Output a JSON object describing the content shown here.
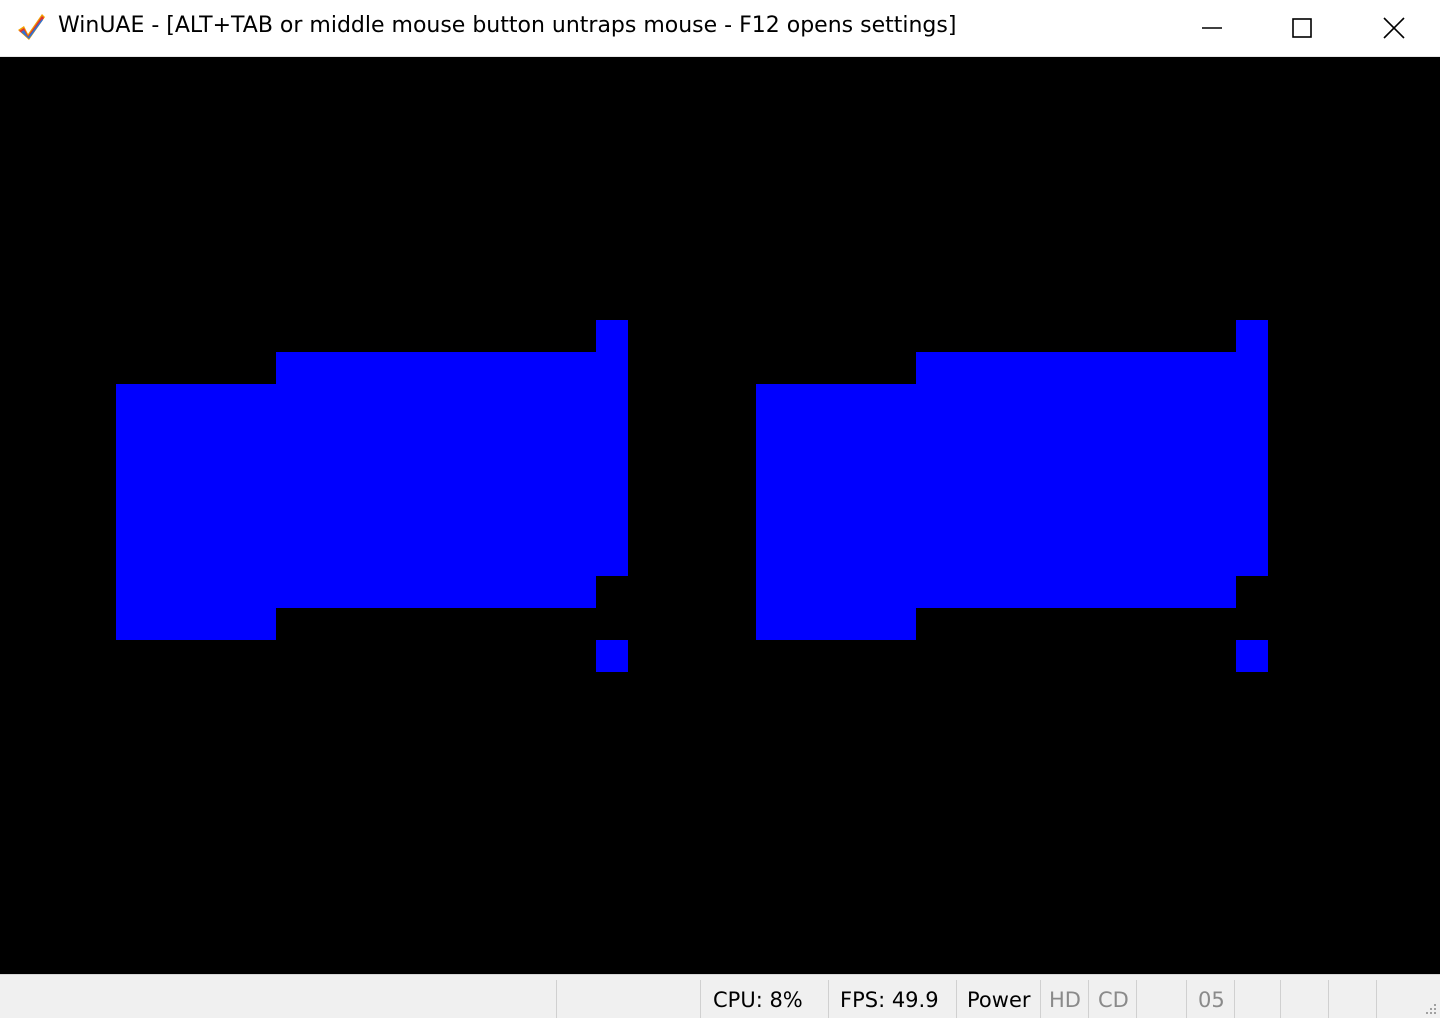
{
  "window": {
    "title": "WinUAE - [ALT+TAB or middle mouse button untraps mouse - F12 opens settings]",
    "app_icon": "winuae-checkmark-icon",
    "controls": {
      "minimize_icon": "minimize-icon",
      "maximize_icon": "maximize-icon",
      "close_icon": "close-icon"
    }
  },
  "display": {
    "background_color": "#000000",
    "graphic_color": "#0000ff",
    "graphic": "two blue pixel shapes on black emulator screen"
  },
  "statusbar": {
    "cells": [
      {
        "id": "blank-1",
        "label": ""
      },
      {
        "id": "blank-2",
        "label": ""
      },
      {
        "id": "cpu",
        "label": "CPU: 8%"
      },
      {
        "id": "fps",
        "label": "FPS: 49.9"
      },
      {
        "id": "power",
        "label": "Power"
      },
      {
        "id": "hd",
        "label": "HD"
      },
      {
        "id": "cd",
        "label": "CD"
      },
      {
        "id": "blank-3",
        "label": ""
      },
      {
        "id": "drive-df0",
        "label": "05"
      },
      {
        "id": "drive-df1",
        "label": ""
      },
      {
        "id": "drive-df2",
        "label": ""
      },
      {
        "id": "drive-df3",
        "label": ""
      }
    ],
    "resize_grip_icon": "resize-grip-icon"
  }
}
